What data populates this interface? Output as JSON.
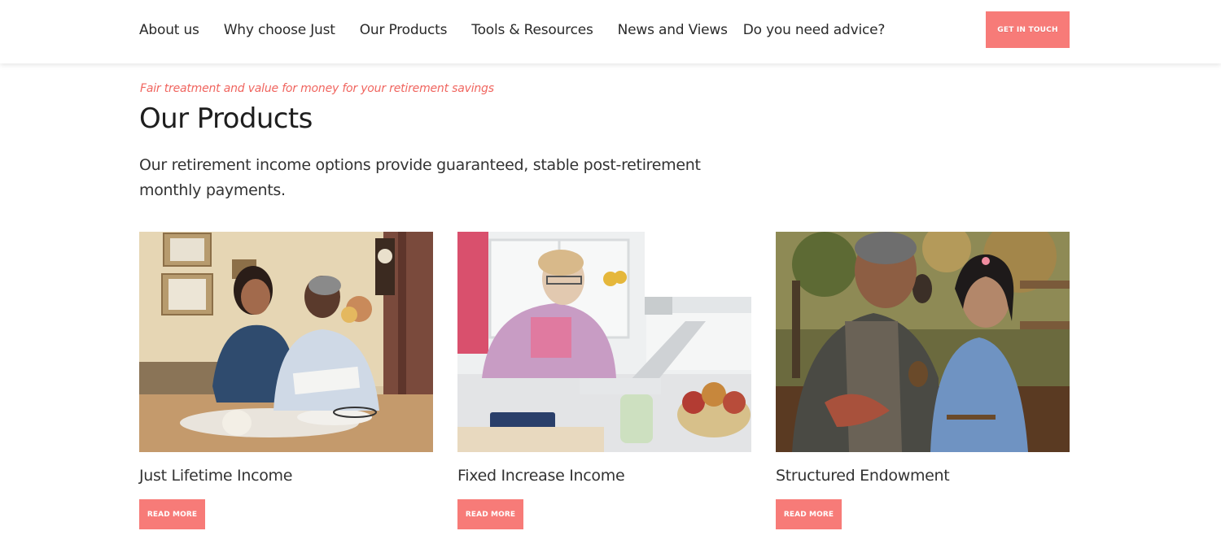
{
  "nav": {
    "items": [
      {
        "label": "About us"
      },
      {
        "label": "Why choose Just"
      },
      {
        "label": "Our Products"
      },
      {
        "label": "Tools & Resources"
      },
      {
        "label": "News and Views"
      },
      {
        "label": "Do you need advice?"
      }
    ],
    "cta_label": "GET IN TOUCH"
  },
  "main": {
    "tagline": "Fair treatment and value for money for your retirement savings",
    "title": "Our Products",
    "intro": "Our retirement income options provide guaranteed, stable post-retirement monthly payments."
  },
  "products": [
    {
      "title": "Just Lifetime Income",
      "button": "READ MORE"
    },
    {
      "title": "Fixed Increase Income",
      "button": "READ MORE"
    },
    {
      "title": "Structured Endowment",
      "button": "READ MORE"
    }
  ],
  "colors": {
    "accent": "#f77b78",
    "tagline": "#f0655f",
    "text": "#333333"
  }
}
